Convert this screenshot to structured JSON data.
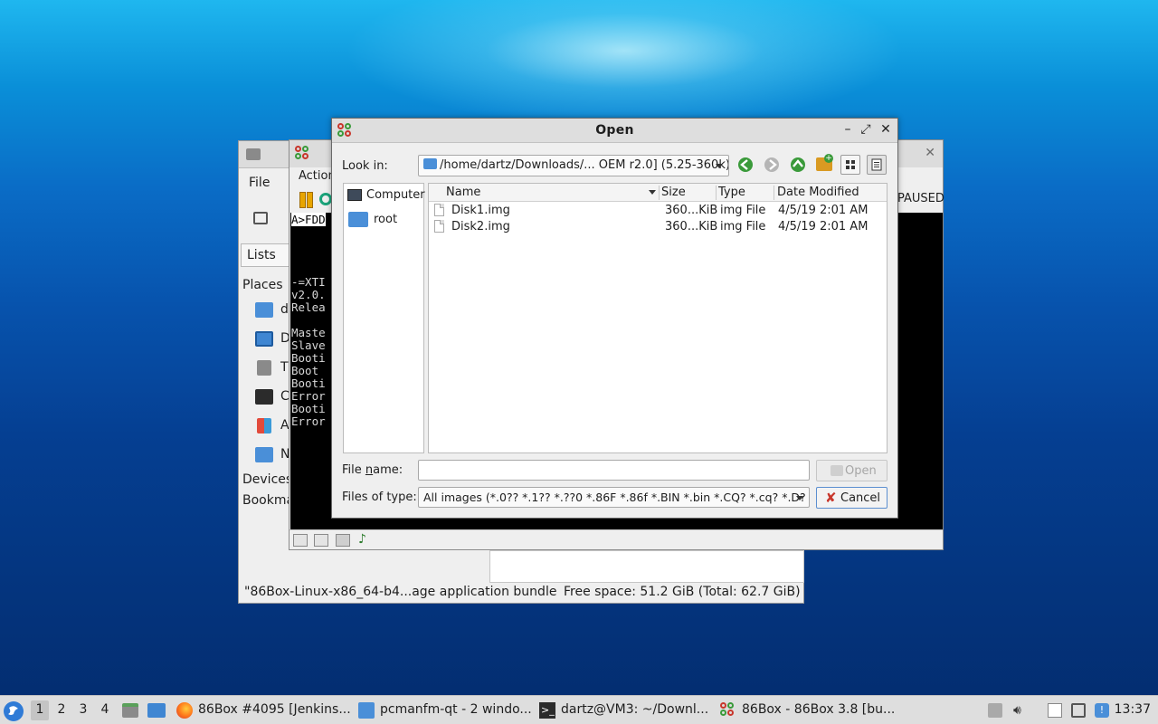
{
  "file_manager": {
    "menu_file": "File",
    "lists_tab": "Lists",
    "places_heading": "Places",
    "side_items": [
      "d",
      "D",
      "T",
      "C",
      "A",
      "N"
    ],
    "devices_heading": "Devices",
    "bookmarks_heading": "Bookma",
    "status_left": "\"86Box-Linux-x86_64-b4...age application bundle",
    "status_right": "Free space: 51.2 GiB (Total: 62.7 GiB)"
  },
  "emulator": {
    "menu_action": "Action",
    "paused_label": "PAUSED",
    "screen": {
      "prompt": "A>FDD",
      "lines": [
        "-=XTI",
        "v2.0.",
        "Relea",
        "",
        "Maste",
        "Slave",
        "Booti",
        "Boot ",
        "Booti",
        "Error",
        "Booti",
        "Error"
      ]
    }
  },
  "dialog": {
    "title": "Open",
    "look_in_label": "Look in:",
    "look_in_value": "/home/dartz/Downloads/... OEM r2.0] (5.25-360k)",
    "sidebar": [
      {
        "label": "Computer",
        "icon": "computer-icon"
      },
      {
        "label": "root",
        "icon": "folder-icon"
      }
    ],
    "columns": [
      "Name",
      "Size",
      "Type",
      "Date Modified"
    ],
    "files": [
      {
        "name": "Disk1.img",
        "size": "360...KiB",
        "type": "img File",
        "date": "4/5/19 2:01 AM"
      },
      {
        "name": "Disk2.img",
        "size": "360...KiB",
        "type": "img File",
        "date": "4/5/19 2:01 AM"
      }
    ],
    "file_name_label_pre": "File ",
    "file_name_label_accel": "n",
    "file_name_label_post": "ame:",
    "file_name_value": "",
    "files_of_type_label": "Files of type:",
    "files_of_type_value": "All images (*.0?? *.1?? *.??0 *.86F *.86f *.BIN *.bin *.CQ? *.cq? *.D?",
    "open_button": "Open",
    "cancel_button": "Cancel"
  },
  "taskbar": {
    "desktops": [
      "1",
      "2",
      "3",
      "4"
    ],
    "tasks": [
      {
        "label": "86Box #4095 [Jenkins...",
        "icon": "firefox-icon"
      },
      {
        "label": "pcmanfm-qt - 2 windo...",
        "icon": "folder-icon"
      },
      {
        "label": "dartz@VM3: ~/Downl...",
        "icon": "terminal-icon"
      },
      {
        "label": "86Box - 86Box 3.8 [bu...",
        "icon": "86box-icon"
      }
    ],
    "clock": "13:37"
  },
  "colors": {
    "accent_blue": "#2f7bd6",
    "folder_blue": "#4a8fd8",
    "nav_green": "#3a9a3a",
    "emu_pause": "#e8a500"
  }
}
